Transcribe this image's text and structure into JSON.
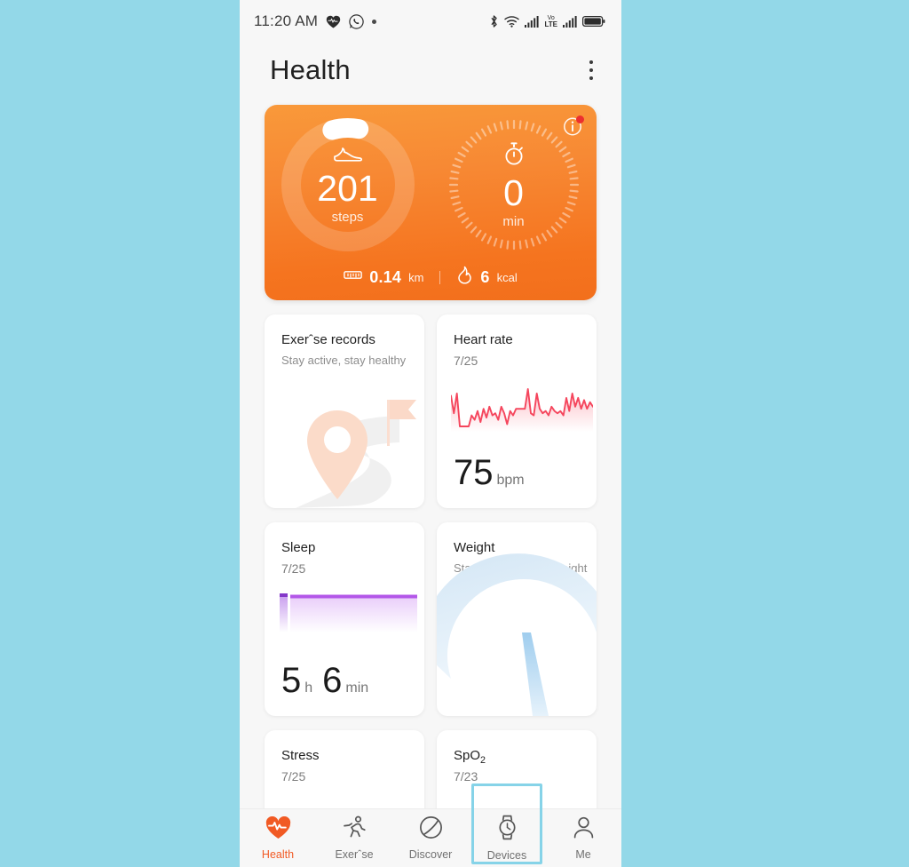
{
  "status_bar": {
    "time": "11:20 AM",
    "left_icons": [
      "heart-rate-icon",
      "whatsapp-icon",
      "dot-indicator"
    ],
    "right_icons": [
      "bluetooth-icon",
      "wifi-icon",
      "signal-bars-icon",
      "volte-icon",
      "signal-bars-2-icon",
      "battery-icon"
    ],
    "volte_top": "Vo",
    "volte_bottom": "LTE"
  },
  "header": {
    "title": "Health",
    "menu": "more-options"
  },
  "hero": {
    "steps": {
      "value": "201",
      "unit": "steps",
      "icon": "shoe-icon"
    },
    "minutes": {
      "value": "0",
      "unit": "min",
      "icon": "stopwatch-icon"
    },
    "distance": {
      "value": "0.14",
      "unit": "km",
      "icon": "ruler-icon"
    },
    "calories": {
      "value": "6",
      "unit": "kcal",
      "icon": "flame-icon"
    },
    "info_icon": "info-icon",
    "has_notification": true,
    "gradient_from": "#f9993a",
    "gradient_to": "#f26f1c"
  },
  "cards": {
    "exercise": {
      "title": "Exerˆse records",
      "subtitle": "Stay active, stay healthy",
      "illustration": "map-pin-route-icon"
    },
    "heart_rate": {
      "title": "Heart rate",
      "date": "7/25",
      "value": "75",
      "unit": "bpm",
      "line_color": "#f5465d"
    },
    "sleep": {
      "title": "Sleep",
      "date": "7/25",
      "hours": "5",
      "hours_unit": "h",
      "minutes": "6",
      "minutes_unit": "min",
      "bar_color": "#b357e8"
    },
    "weight": {
      "title": "Weight",
      "subtitle": "Stay on top of your weight",
      "illustration": "scale-gauge-icon"
    },
    "stress": {
      "title": "Stress",
      "date": "7/25"
    },
    "spo2": {
      "title": "SpO",
      "title_sub": "2",
      "date": "7/23"
    }
  },
  "chart_data": [
    {
      "type": "line",
      "title": "Heart rate",
      "ylabel": "bpm",
      "x": [
        0,
        1,
        2,
        3,
        4,
        5,
        6,
        7,
        8,
        9,
        10,
        11,
        12,
        13,
        14,
        15,
        16,
        17,
        18,
        19,
        20,
        21,
        22,
        23,
        24,
        25,
        26,
        27,
        28,
        29,
        30,
        31,
        32,
        33,
        34,
        35,
        36,
        37,
        38,
        39,
        40,
        41,
        42,
        43,
        44,
        45,
        46,
        47,
        48
      ],
      "values": [
        88,
        72,
        90,
        60,
        60,
        60,
        60,
        70,
        66,
        74,
        64,
        76,
        68,
        78,
        70,
        72,
        66,
        78,
        72,
        62,
        74,
        70,
        76,
        76,
        76,
        76,
        94,
        72,
        70,
        90,
        76,
        72,
        74,
        70,
        78,
        74,
        72,
        74,
        70,
        86,
        74,
        90,
        78,
        86,
        76,
        84,
        76,
        82,
        78
      ],
      "latest_value": 75,
      "grid": false,
      "legend": "none"
    },
    {
      "type": "bar",
      "title": "Sleep",
      "categories": [
        "segment-1",
        "segment-2"
      ],
      "values": [
        1,
        11
      ],
      "total_hours": 5,
      "total_minutes": 6,
      "grid": false,
      "legend": "none"
    }
  ],
  "bottom_nav": [
    {
      "label": "Health",
      "icon": "heart-pulse-icon",
      "active": true,
      "highlighted": false
    },
    {
      "label": "Exerˆse",
      "icon": "running-icon",
      "active": false,
      "highlighted": false
    },
    {
      "label": "Discover",
      "icon": "compass-icon",
      "active": false,
      "highlighted": false
    },
    {
      "label": "Devices",
      "icon": "watch-icon",
      "active": false,
      "highlighted": true
    },
    {
      "label": "Me",
      "icon": "person-icon",
      "active": false,
      "highlighted": false
    }
  ],
  "colors": {
    "background": "#93d8e8",
    "accent": "#f15a24",
    "highlight": "#86d3e8"
  }
}
